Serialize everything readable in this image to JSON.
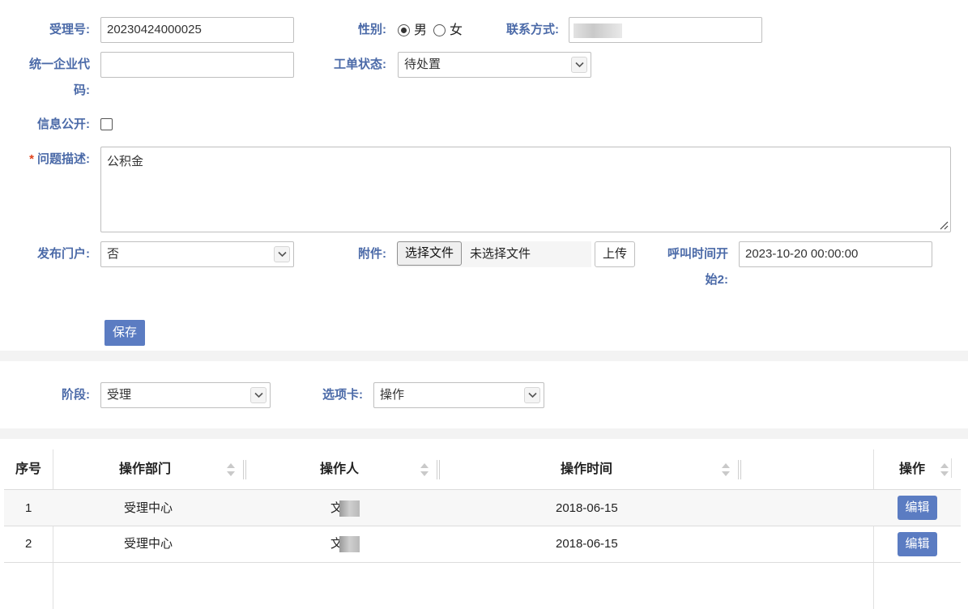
{
  "form": {
    "accept_no": {
      "label": "受理号:",
      "value": "20230424000025"
    },
    "gender": {
      "label": "性别:",
      "options": [
        "男",
        "女"
      ],
      "selected": "男"
    },
    "contact": {
      "label": "联系方式:"
    },
    "credit_code": {
      "label_line1": "统一企业代",
      "label_line2": "码:",
      "value": ""
    },
    "status": {
      "label": "工单状态:",
      "value": "待处置"
    },
    "public_info": {
      "label": "信息公开:",
      "checked": false
    },
    "description": {
      "required_mark": "*",
      "label": "问题描述:",
      "value": "公积金"
    },
    "publish_portal": {
      "label": "发布门户:",
      "value": "否"
    },
    "attachment": {
      "label": "附件:",
      "choose_button": "选择文件",
      "no_file_text": "未选择文件",
      "upload_button": "上传"
    },
    "call_start": {
      "label_line1": "呼叫时间开",
      "label_line2": "始2:",
      "value": "2023-10-20 00:00:00"
    },
    "save_button": "保存"
  },
  "filters": {
    "stage": {
      "label": "阶段:",
      "value": "受理"
    },
    "tab_card": {
      "label": "选项卡:",
      "value": "操作"
    }
  },
  "table": {
    "columns": [
      "序号",
      "操作部门",
      "操作人",
      "操作时间",
      "操作"
    ],
    "rows": [
      {
        "no": "1",
        "dept": "受理中心",
        "operator": "文",
        "time": "2018-06-15",
        "action": "编辑"
      },
      {
        "no": "2",
        "dept": "受理中心",
        "operator": "文",
        "time": "2018-06-15",
        "action": "编辑"
      }
    ]
  },
  "colors": {
    "label": "#4b6aa8",
    "primary_button": "#5b7cc2",
    "required": "#e0421b",
    "section_band": "#f3f3f3"
  },
  "icons": [
    "chevron-down-icon",
    "sort-icon",
    "resize-grip-icon"
  ]
}
